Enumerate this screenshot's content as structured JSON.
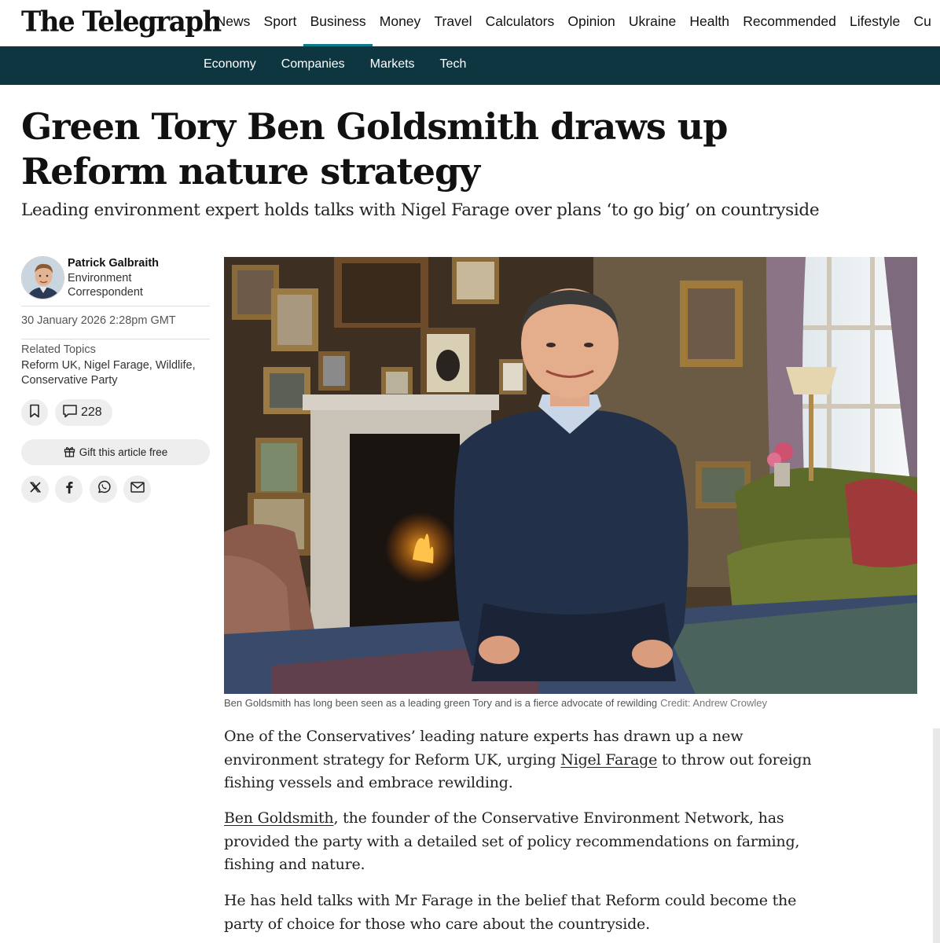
{
  "brand": {
    "logo_text": "The Telegraph",
    "accent": "#0b7c8a",
    "subnav_bg": "#0e3641"
  },
  "nav": {
    "items": [
      "News",
      "Sport",
      "Business",
      "Money",
      "Travel",
      "Calculators",
      "Opinion",
      "Ukraine",
      "Health",
      "Recommended",
      "Lifestyle",
      "Cu"
    ],
    "active": "Business"
  },
  "subnav": {
    "items": [
      "Economy",
      "Companies",
      "Markets",
      "Tech"
    ]
  },
  "article": {
    "headline": "Green Tory Ben Goldsmith draws up Reform nature strategy",
    "standfirst": "Leading environment expert holds talks with Nigel Farage over plans ‘to go big’ on countryside",
    "author": {
      "name": "Patrick Galbraith",
      "role": "Environment Correspondent"
    },
    "date": "30 January 2026 2:28pm GMT",
    "related_topics_label": "Related Topics",
    "related_topics": "Reform UK, Nigel Farage, Wildlife, Conservative Party",
    "comment_count": "228",
    "gift_label": "Gift this article free",
    "share_icons": [
      "x-icon",
      "facebook-icon",
      "whatsapp-icon",
      "email-icon"
    ],
    "image_caption": "Ben Goldsmith has long been seen as a leading green Tory and is a fierce advocate of rewilding",
    "image_credit": "Credit: Andrew Crowley",
    "paragraphs": [
      {
        "before": "One of the Conservatives’ leading nature experts has drawn up a new environment strategy for Reform UK, urging ",
        "link": "Nigel Farage",
        "after": " to throw out foreign fishing vessels and embrace rewilding."
      },
      {
        "before": "",
        "link": "Ben Goldsmith",
        "after": ", the founder of the Conservative Environment Network, has provided the party with a detailed set of policy recommendations on farming, fishing and nature."
      },
      {
        "before": "He has held talks with Mr Farage in the belief that Reform could become the party of choice for those who care about the countryside.",
        "link": "",
        "after": ""
      }
    ]
  }
}
